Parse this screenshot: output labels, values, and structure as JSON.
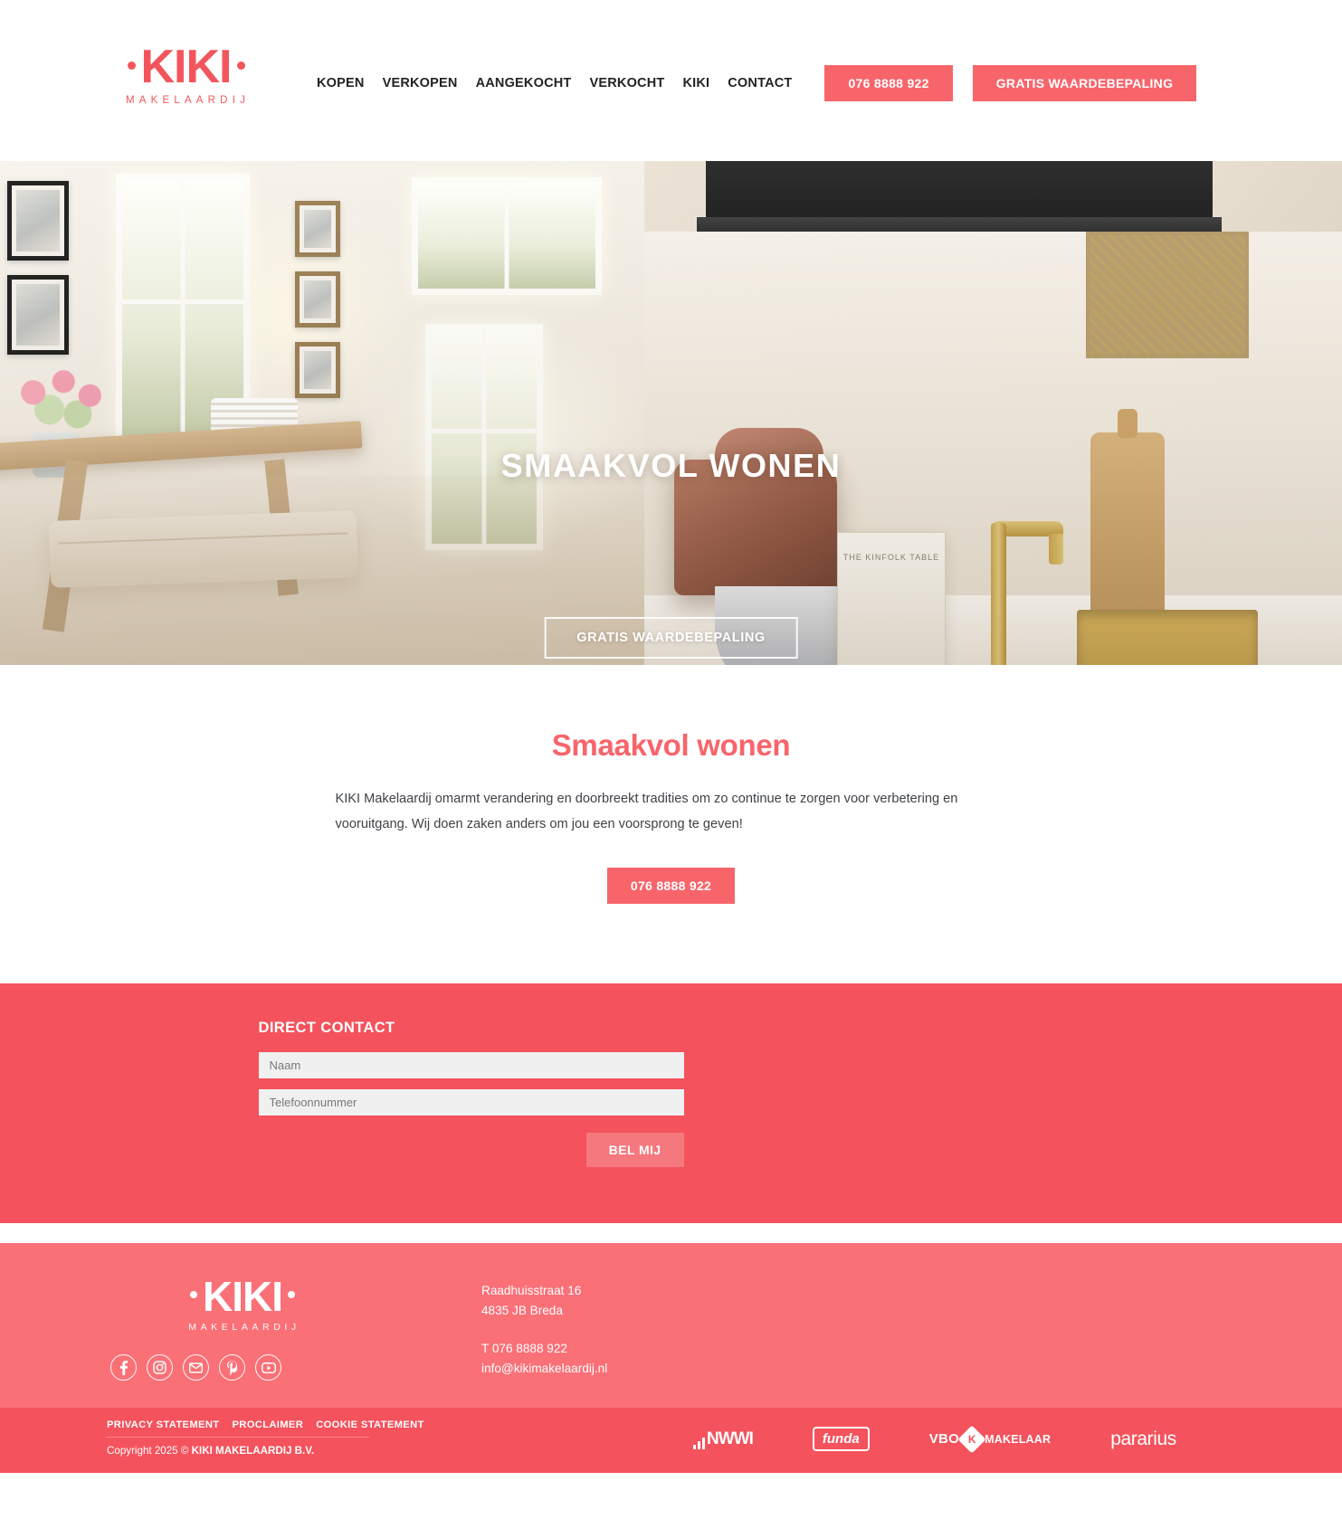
{
  "brand": {
    "name": "KIKI",
    "tagline": "MAKELAARDIJ"
  },
  "colors": {
    "accent": "#F7656B",
    "accent_dark": "#F4525C",
    "footer_bg": "#FA7077",
    "field_bg": "#F0F0F0"
  },
  "header": {
    "nav": [
      {
        "label": "KOPEN"
      },
      {
        "label": "VERKOPEN"
      },
      {
        "label": "AANGEKOCHT"
      },
      {
        "label": "VERKOCHT"
      },
      {
        "label": "KIKI"
      },
      {
        "label": "CONTACT"
      }
    ],
    "phone_button": "076 8888 922",
    "valuation_button": "GRATIS WAARDEBEPALING"
  },
  "hero": {
    "title": "SMAAKVOL WONEN",
    "cta": "GRATIS WAARDEBEPALING"
  },
  "intro": {
    "title": "Smaakvol wonen",
    "paragraph": "KIKI Makelaardij omarmt verandering en doorbreekt tradities om zo continue te zorgen voor verbetering en vooruitgang. Wij doen zaken anders om jou een voorsprong te geven!",
    "phone_button": "076 8888 922"
  },
  "contact": {
    "title": "DIRECT CONTACT",
    "name_placeholder": "Naam",
    "name_value": "",
    "phone_placeholder": "Telefoonnummer",
    "phone_value": "",
    "submit_label": "BEL MIJ"
  },
  "footer": {
    "address_line1": "Raadhuisstraat 16",
    "address_line2": "4835 JB Breda",
    "phone": "T 076 8888 922",
    "email": "info@kikimakelaardij.nl",
    "social": [
      {
        "name": "facebook",
        "glyph": "f"
      },
      {
        "name": "instagram",
        "glyph": "instagram"
      },
      {
        "name": "email",
        "glyph": "envelope"
      },
      {
        "name": "pinterest",
        "glyph": "P"
      },
      {
        "name": "youtube",
        "glyph": "play"
      }
    ],
    "legal_links": [
      {
        "label": "PRIVACY STATEMENT"
      },
      {
        "label": "PROCLAIMER"
      },
      {
        "label": "COOKIE STATEMENT"
      }
    ],
    "copyright_prefix": "Copyright 2025 © ",
    "copyright_company": "KIKI MAKELAARDIJ B.V.",
    "partners": [
      {
        "label": "NWWI"
      },
      {
        "label": "funda"
      },
      {
        "label": "VBO"
      },
      {
        "label": "MAKELAAR"
      },
      {
        "label": "pararius"
      }
    ]
  }
}
